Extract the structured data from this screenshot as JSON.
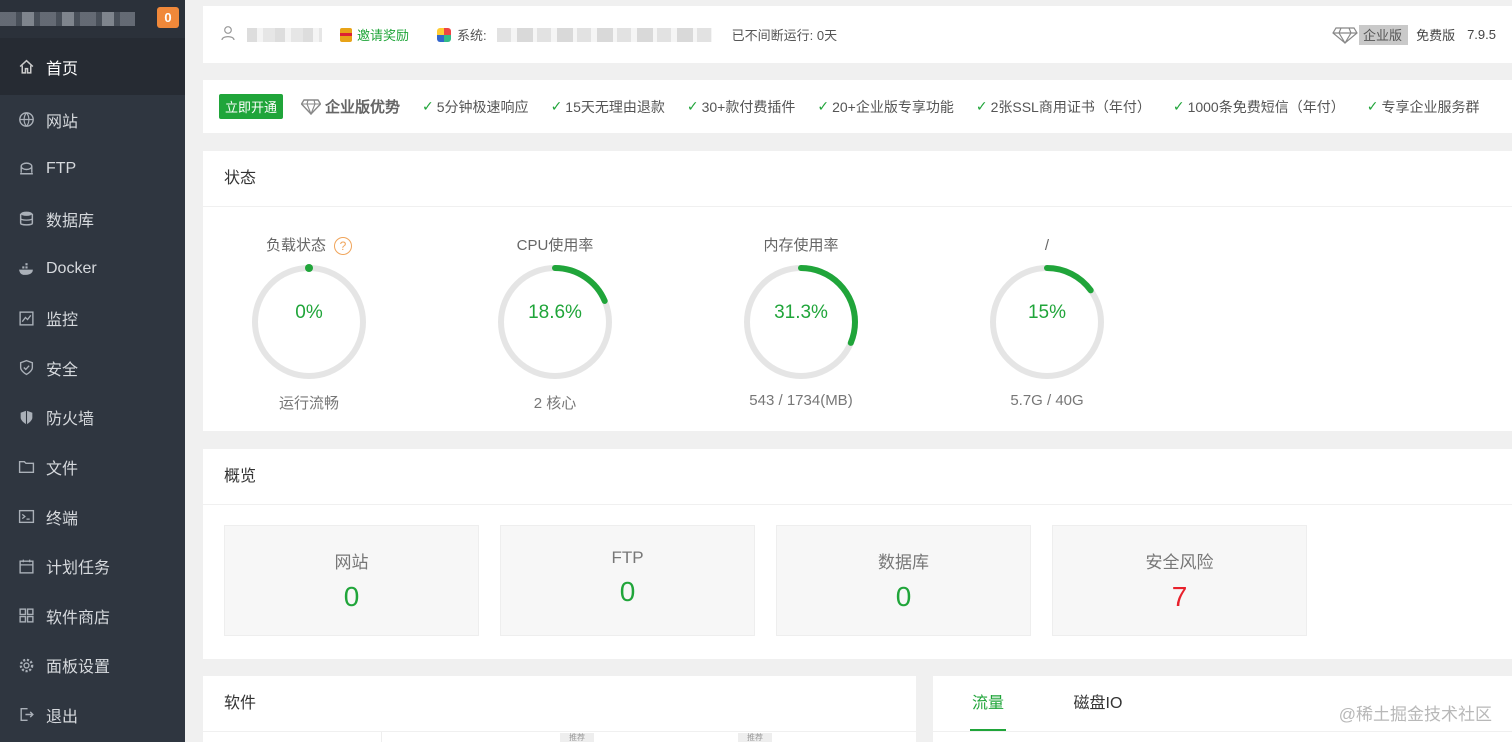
{
  "sidebar": {
    "badge": "0",
    "items": [
      {
        "label": "首页",
        "icon": "home-icon"
      },
      {
        "label": "网站",
        "icon": "globe-icon"
      },
      {
        "label": "FTP",
        "icon": "ftp-icon"
      },
      {
        "label": "数据库",
        "icon": "database-icon"
      },
      {
        "label": "Docker",
        "icon": "docker-icon"
      },
      {
        "label": "监控",
        "icon": "monitor-icon"
      },
      {
        "label": "安全",
        "icon": "shield-check-icon"
      },
      {
        "label": "防火墙",
        "icon": "firewall-icon"
      },
      {
        "label": "文件",
        "icon": "folder-icon"
      },
      {
        "label": "终端",
        "icon": "terminal-icon"
      },
      {
        "label": "计划任务",
        "icon": "calendar-icon"
      },
      {
        "label": "软件商店",
        "icon": "grid-icon"
      },
      {
        "label": "面板设置",
        "icon": "gear-icon"
      },
      {
        "label": "退出",
        "icon": "logout-icon"
      }
    ]
  },
  "topbar": {
    "invite_label": "邀请奖励",
    "system_label": "系统:",
    "uptime": "已不间断运行: 0天",
    "enterprise_label": "企业版",
    "free_label": "免费版",
    "version": "7.9.5"
  },
  "promo": {
    "open_button": "立即开通",
    "advantage_title": "企业版优势",
    "features": [
      "5分钟极速响应",
      "15天无理由退款",
      "30+款付费插件",
      "20+企业版专享功能",
      "2张SSL商用证书（年付）",
      "1000条免费短信（年付）",
      "专享企业服务群"
    ]
  },
  "status": {
    "title": "状态",
    "gauges": [
      {
        "title": "负载状态",
        "value": "0%",
        "percent": 0,
        "sub": "运行流畅",
        "help": "?"
      },
      {
        "title": "CPU使用率",
        "value": "18.6%",
        "percent": 18.6,
        "sub": "2 核心"
      },
      {
        "title": "内存使用率",
        "value": "31.3%",
        "percent": 31.3,
        "sub": "543 / 1734(MB)"
      },
      {
        "title": "/",
        "value": "15%",
        "percent": 15,
        "sub": "5.7G / 40G"
      }
    ],
    "accent_color": "#20a53a",
    "track_color": "#e5e5e5"
  },
  "overview": {
    "title": "概览",
    "cards": [
      {
        "label": "网站",
        "value": "0"
      },
      {
        "label": "FTP",
        "value": "0"
      },
      {
        "label": "数据库",
        "value": "0"
      },
      {
        "label": "安全风险",
        "value": "7"
      }
    ]
  },
  "software": {
    "title": "软件",
    "tag": "推荐"
  },
  "traffic": {
    "tabs": [
      "流量",
      "磁盘IO"
    ]
  },
  "watermark": "@稀土掘金技术社区"
}
